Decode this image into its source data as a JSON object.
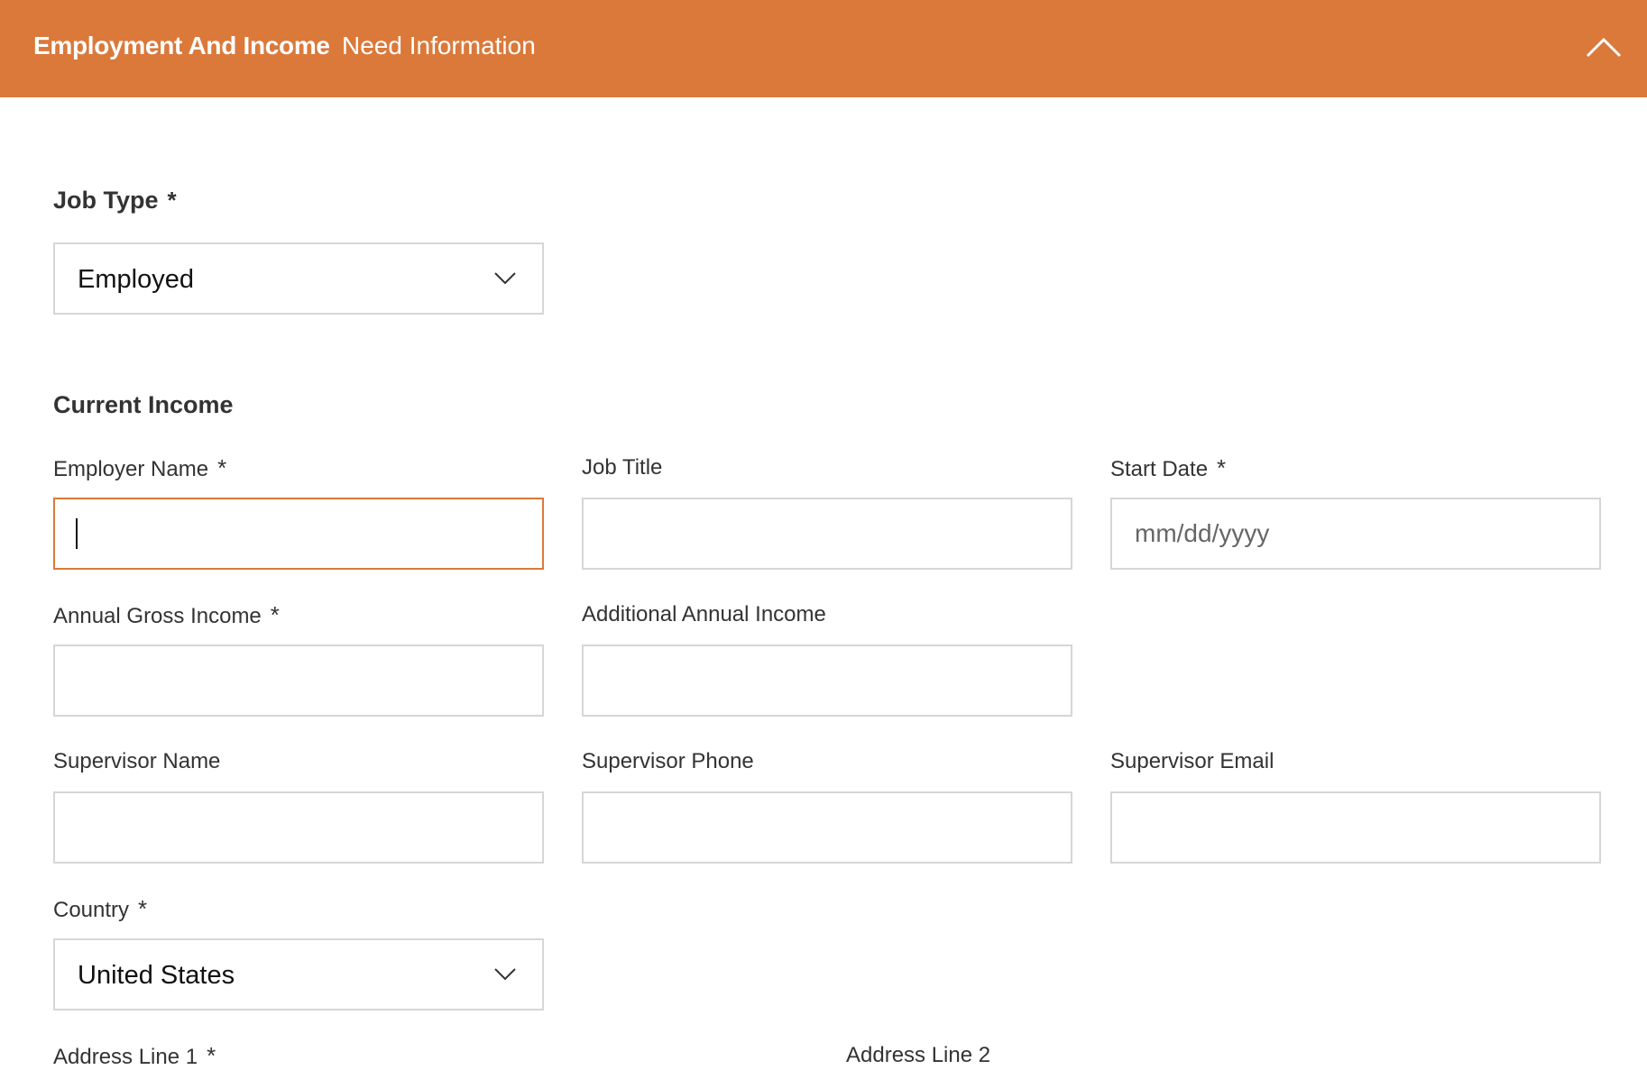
{
  "header": {
    "title": "Employment And Income",
    "status": "Need Information",
    "collapse_icon": "chevron-up-icon"
  },
  "job_type": {
    "label": "Job Type",
    "required_mark": "*",
    "selected": "Employed"
  },
  "current_income": {
    "heading": "Current Income",
    "employer_name": {
      "label": "Employer Name",
      "required_mark": "*",
      "value": ""
    },
    "job_title": {
      "label": "Job Title",
      "value": ""
    },
    "start_date": {
      "label": "Start Date",
      "required_mark": "*",
      "placeholder": "mm/dd/yyyy"
    },
    "annual_gross_income": {
      "label": "Annual Gross Income",
      "required_mark": "*",
      "value": ""
    },
    "additional_annual_income": {
      "label": "Additional Annual Income",
      "value": ""
    },
    "supervisor_name": {
      "label": "Supervisor Name",
      "value": ""
    },
    "supervisor_phone": {
      "label": "Supervisor Phone",
      "value": ""
    },
    "supervisor_email": {
      "label": "Supervisor Email",
      "value": ""
    },
    "country": {
      "label": "Country",
      "required_mark": "*",
      "selected": "United States"
    },
    "address_line_1": {
      "label": "Address Line 1",
      "required_mark": "*"
    },
    "address_line_2": {
      "label": "Address Line 2"
    }
  },
  "colors": {
    "accent": "#DB793A",
    "border": "#d6d6d6",
    "text": "#333333"
  }
}
